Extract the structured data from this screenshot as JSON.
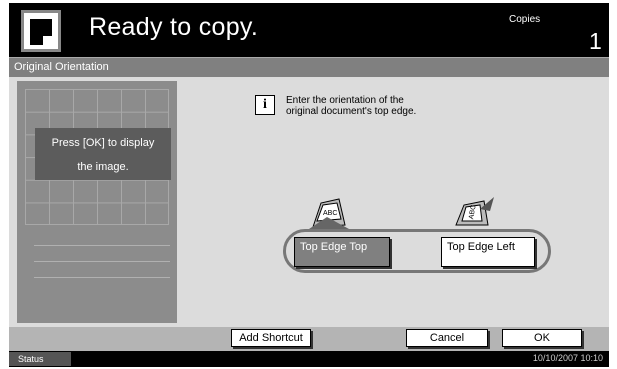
{
  "header": {
    "status": "Ready to copy.",
    "copies_label": "Copies",
    "copies_value": "1"
  },
  "title": "Original Orientation",
  "preview": {
    "message_line1": "Press [OK] to display",
    "message_line2": "the image."
  },
  "info": {
    "line1": "Enter the orientation of the",
    "line2": "original document's top edge."
  },
  "orientation": {
    "options": [
      "Top Edge Top",
      "Top Edge Left"
    ],
    "selected": "Top Edge Top"
  },
  "bottom": {
    "add_shortcut": "Add Shortcut",
    "cancel": "Cancel",
    "ok": "OK"
  },
  "statusbar": {
    "status": "Status",
    "datetime": "10/10/2007   10:10"
  },
  "colors": {
    "header_bg": "#000000",
    "panel_bg": "#dcdcdc",
    "selected_button": "#808080"
  }
}
